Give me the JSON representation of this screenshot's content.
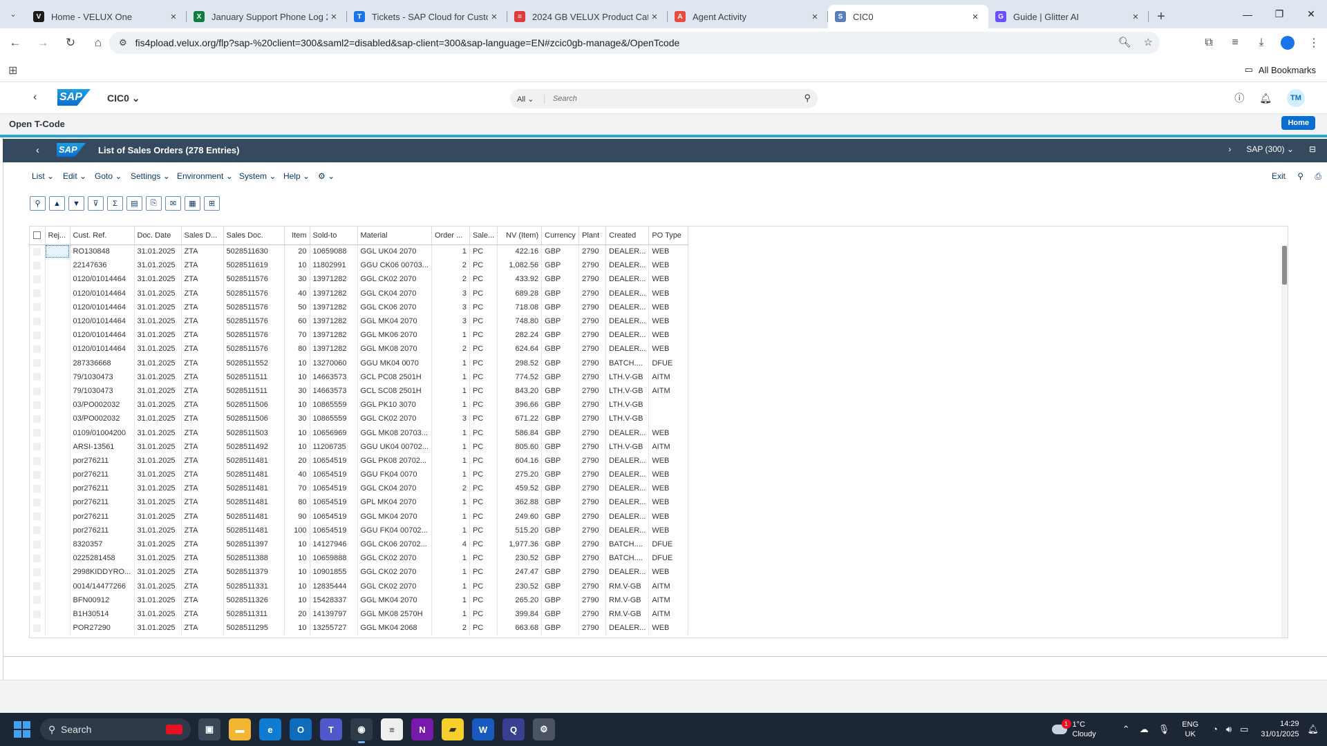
{
  "browser": {
    "tabs": [
      {
        "title": "Home - VELUX One",
        "color": "#1a1a1a",
        "glyph": "V"
      },
      {
        "title": "January Support Phone Log 20...",
        "color": "#107c41",
        "glyph": "X"
      },
      {
        "title": "Tickets - SAP Cloud for Custom...",
        "color": "#1a73e8",
        "glyph": "T"
      },
      {
        "title": "2024 GB VELUX Product Catalo...",
        "color": "#e03b3b",
        "glyph": "≡"
      },
      {
        "title": "Agent Activity",
        "color": "#e74c3c",
        "glyph": "A"
      },
      {
        "title": "CIC0",
        "color": "#5b7db8",
        "glyph": "S"
      },
      {
        "title": "Guide | Glitter AI",
        "color": "#6b4eff",
        "glyph": "G"
      }
    ],
    "url": "fis4pload.velux.org/flp?sap-%20client=300&saml2=disabled&sap-client=300&sap-language=EN#zcic0gb-manage&/OpenTcode",
    "all_bookmarks": "All Bookmarks"
  },
  "shell": {
    "app_title": "CIC0",
    "logo": "SAP",
    "search_scope": "All",
    "search_placeholder": "Search",
    "avatar": "TM"
  },
  "subheader": {
    "title": "Open T-Code",
    "home_button": "Home"
  },
  "gui": {
    "title": "List of Sales Orders (278 Entries)",
    "system": "SAP (300)",
    "menus": [
      "List",
      "Edit",
      "Goto",
      "Settings",
      "Environment",
      "System",
      "Help"
    ],
    "exit": "Exit"
  },
  "table": {
    "columns": [
      "Rej...",
      "Cust. Ref.",
      "Doc. Date",
      "Sales D...",
      "Sales Doc.",
      "Item",
      "Sold-to",
      "Material",
      "Order ...",
      "Sale...",
      "NV (Item)",
      "Currency",
      "Plant",
      "Created",
      "PO Type"
    ],
    "rows": [
      [
        "RO130848",
        "31.01.2025",
        "ZTA",
        "5028511630",
        "20",
        "10659088",
        "GGL UK04 2070",
        "1",
        "PC",
        "422.16",
        "GBP",
        "2790",
        "DEALER...",
        "WEB"
      ],
      [
        "22147636",
        "31.01.2025",
        "ZTA",
        "5028511619",
        "10",
        "11802991",
        "GGU CK06 00703...",
        "2",
        "PC",
        "1,082.56",
        "GBP",
        "2790",
        "DEALER...",
        "WEB"
      ],
      [
        "0120/01014464",
        "31.01.2025",
        "ZTA",
        "5028511576",
        "30",
        "13971282",
        "GGL CK02 2070",
        "2",
        "PC",
        "433.92",
        "GBP",
        "2790",
        "DEALER...",
        "WEB"
      ],
      [
        "0120/01014464",
        "31.01.2025",
        "ZTA",
        "5028511576",
        "40",
        "13971282",
        "GGL CK04 2070",
        "3",
        "PC",
        "689.28",
        "GBP",
        "2790",
        "DEALER...",
        "WEB"
      ],
      [
        "0120/01014464",
        "31.01.2025",
        "ZTA",
        "5028511576",
        "50",
        "13971282",
        "GGL CK06 2070",
        "3",
        "PC",
        "718.08",
        "GBP",
        "2790",
        "DEALER...",
        "WEB"
      ],
      [
        "0120/01014464",
        "31.01.2025",
        "ZTA",
        "5028511576",
        "60",
        "13971282",
        "GGL MK04 2070",
        "3",
        "PC",
        "748.80",
        "GBP",
        "2790",
        "DEALER...",
        "WEB"
      ],
      [
        "0120/01014464",
        "31.01.2025",
        "ZTA",
        "5028511576",
        "70",
        "13971282",
        "GGL MK06 2070",
        "1",
        "PC",
        "282.24",
        "GBP",
        "2790",
        "DEALER...",
        "WEB"
      ],
      [
        "0120/01014464",
        "31.01.2025",
        "ZTA",
        "5028511576",
        "80",
        "13971282",
        "GGL MK08 2070",
        "2",
        "PC",
        "624.64",
        "GBP",
        "2790",
        "DEALER...",
        "WEB"
      ],
      [
        "287336668",
        "31.01.2025",
        "ZTA",
        "5028511552",
        "10",
        "13270060",
        "GGU MK04 0070",
        "1",
        "PC",
        "298.52",
        "GBP",
        "2790",
        "BATCH....",
        "DFUE"
      ],
      [
        "79/1030473",
        "31.01.2025",
        "ZTA",
        "5028511511",
        "10",
        "14663573",
        "GCL PC08 2501H",
        "1",
        "PC",
        "774.52",
        "GBP",
        "2790",
        "LTH.V-GB",
        "AITM"
      ],
      [
        "79/1030473",
        "31.01.2025",
        "ZTA",
        "5028511511",
        "30",
        "14663573",
        "GCL SC08 2501H",
        "1",
        "PC",
        "843.20",
        "GBP",
        "2790",
        "LTH.V-GB",
        "AITM"
      ],
      [
        "03/PO002032",
        "31.01.2025",
        "ZTA",
        "5028511506",
        "10",
        "10865559",
        "GGL PK10 3070",
        "1",
        "PC",
        "396.66",
        "GBP",
        "2790",
        "LTH.V-GB",
        ""
      ],
      [
        "03/PO002032",
        "31.01.2025",
        "ZTA",
        "5028511506",
        "30",
        "10865559",
        "GGL CK02 2070",
        "3",
        "PC",
        "671.22",
        "GBP",
        "2790",
        "LTH.V-GB",
        ""
      ],
      [
        "0109/01004200",
        "31.01.2025",
        "ZTA",
        "5028511503",
        "10",
        "10656969",
        "GGL MK08 20703...",
        "1",
        "PC",
        "586.84",
        "GBP",
        "2790",
        "DEALER...",
        "WEB"
      ],
      [
        "ARSI-13561",
        "31.01.2025",
        "ZTA",
        "5028511492",
        "10",
        "11206735",
        "GGU UK04 00702...",
        "1",
        "PC",
        "805.60",
        "GBP",
        "2790",
        "LTH.V-GB",
        "AITM"
      ],
      [
        "por276211",
        "31.01.2025",
        "ZTA",
        "5028511481",
        "20",
        "10654519",
        "GGL PK08 20702...",
        "1",
        "PC",
        "604.16",
        "GBP",
        "2790",
        "DEALER...",
        "WEB"
      ],
      [
        "por276211",
        "31.01.2025",
        "ZTA",
        "5028511481",
        "40",
        "10654519",
        "GGU FK04 0070",
        "1",
        "PC",
        "275.20",
        "GBP",
        "2790",
        "DEALER...",
        "WEB"
      ],
      [
        "por276211",
        "31.01.2025",
        "ZTA",
        "5028511481",
        "70",
        "10654519",
        "GGL CK04 2070",
        "2",
        "PC",
        "459.52",
        "GBP",
        "2790",
        "DEALER...",
        "WEB"
      ],
      [
        "por276211",
        "31.01.2025",
        "ZTA",
        "5028511481",
        "80",
        "10654519",
        "GPL MK04 2070",
        "1",
        "PC",
        "362.88",
        "GBP",
        "2790",
        "DEALER...",
        "WEB"
      ],
      [
        "por276211",
        "31.01.2025",
        "ZTA",
        "5028511481",
        "90",
        "10654519",
        "GGL MK04 2070",
        "1",
        "PC",
        "249.60",
        "GBP",
        "2790",
        "DEALER...",
        "WEB"
      ],
      [
        "por276211",
        "31.01.2025",
        "ZTA",
        "5028511481",
        "100",
        "10654519",
        "GGU FK04 00702...",
        "1",
        "PC",
        "515.20",
        "GBP",
        "2790",
        "DEALER...",
        "WEB"
      ],
      [
        "8320357",
        "31.01.2025",
        "ZTA",
        "5028511397",
        "10",
        "14127946",
        "GGL CK06 20702...",
        "4",
        "PC",
        "1,977.36",
        "GBP",
        "2790",
        "BATCH....",
        "DFUE"
      ],
      [
        "0225281458",
        "31.01.2025",
        "ZTA",
        "5028511388",
        "10",
        "10659888",
        "GGL CK02 2070",
        "1",
        "PC",
        "230.52",
        "GBP",
        "2790",
        "BATCH....",
        "DFUE"
      ],
      [
        "2998KIDDYRO...",
        "31.01.2025",
        "ZTA",
        "5028511379",
        "10",
        "10901855",
        "GGL CK02 2070",
        "1",
        "PC",
        "247.47",
        "GBP",
        "2790",
        "DEALER...",
        "WEB"
      ],
      [
        "0014/14477266",
        "31.01.2025",
        "ZTA",
        "5028511331",
        "10",
        "12835444",
        "GGL CK02 2070",
        "1",
        "PC",
        "230.52",
        "GBP",
        "2790",
        "RM.V-GB",
        "AITM"
      ],
      [
        "BFN00912",
        "31.01.2025",
        "ZTA",
        "5028511326",
        "10",
        "15428337",
        "GGL MK04 2070",
        "1",
        "PC",
        "265.20",
        "GBP",
        "2790",
        "RM.V-GB",
        "AITM"
      ],
      [
        "B1H30514",
        "31.01.2025",
        "ZTA",
        "5028511311",
        "20",
        "14139797",
        "GGL MK08 2570H",
        "1",
        "PC",
        "399.84",
        "GBP",
        "2790",
        "RM.V-GB",
        "AITM"
      ],
      [
        "POR27290",
        "31.01.2025",
        "ZTA",
        "5028511295",
        "10",
        "13255727",
        "GGL MK04 2068",
        "2",
        "PC",
        "663.68",
        "GBP",
        "2790",
        "DEALER...",
        "WEB"
      ]
    ]
  },
  "taskbar": {
    "search": "Search",
    "weather_temp": "1°C",
    "weather_desc": "Cloudy",
    "weather_badge": "1",
    "lang1": "ENG",
    "lang2": "UK",
    "time": "14:29",
    "date": "31/01/2025"
  }
}
